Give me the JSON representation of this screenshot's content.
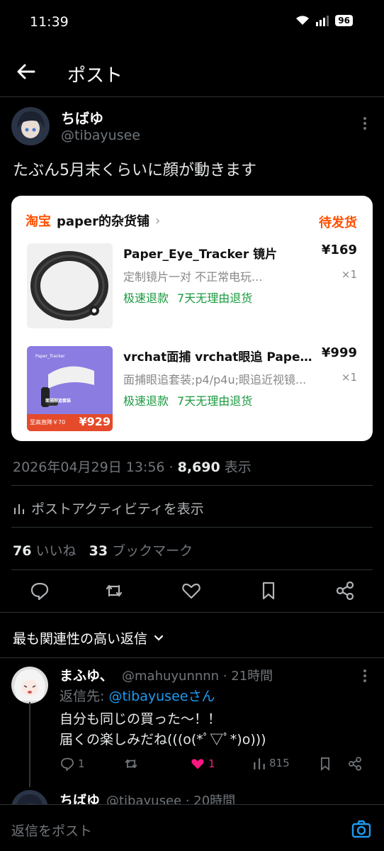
{
  "status_bar": {
    "time": "11:39",
    "battery": "96"
  },
  "header": {
    "title": "ポスト"
  },
  "post": {
    "author_name": "ちばゆ",
    "author_handle": "@tibayusee",
    "text": "たぶん5月末くらいに顔が動きます",
    "timestamp": "2026年04月29日 13:56 · ",
    "views": "8,690",
    "views_label": " 表示",
    "activity_label": "ポストアクティビティを表示",
    "likes": "76",
    "likes_label": " いいね",
    "bookmarks": "33",
    "bookmarks_label": " ブックマーク"
  },
  "order_card": {
    "shop_logo": "淘宝",
    "shop_name": "paper的杂货铺",
    "status": "待发货",
    "items": [
      {
        "title": "Paper_Eye_Tracker 镜片",
        "price": "¥169",
        "spec": "定制镜片一对 不正常电玩...",
        "qty": "×1",
        "tag1": "极速退款",
        "tag2": "7天无理由退货"
      },
      {
        "title": "vrchat面捕 vrchat眼追 Paper_Eye_Tracker",
        "price": "¥999",
        "spec": "面捕眼追套装;p4/p4u;眼追近视镜...",
        "qty": "×1",
        "tag1": "极速退款",
        "tag2": "7天无理由退货",
        "image_brand": "Paper_Tracker",
        "image_caption": "面捕眼追套装",
        "image_discount": "至高直降￥70",
        "image_price": "¥929"
      }
    ]
  },
  "sort": {
    "label": "最も関連性の高い返信"
  },
  "replies": [
    {
      "name": "まふゆ、",
      "handle": "@mahuyunnnn · 21時間",
      "reply_to_prefix": "返信先: ",
      "reply_to_user": "@tibayuseeさん",
      "line1": "自分も同じの買った〜！！",
      "line2": "届くの楽しみだね(((o(*ﾟ▽ﾟ*)o)))",
      "reply_count": "1",
      "like_count": "1",
      "view_count": "815"
    },
    {
      "name": "ちばゆ",
      "handle": "@tibayusee · 20時間"
    }
  ],
  "composer": {
    "placeholder": "返信をポスト"
  },
  "colors": {
    "accent": "#1d9bf0",
    "like": "#f91880",
    "taobao": "#ff5000",
    "tag": "#1a9a3e"
  }
}
